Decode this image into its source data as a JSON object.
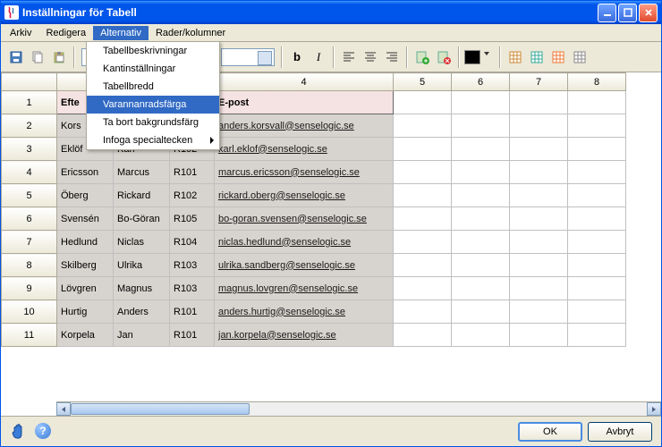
{
  "window": {
    "title": "Inställningar för Tabell"
  },
  "menubar": {
    "items": [
      "Arkiv",
      "Redigera",
      "Alternativ",
      "Rader/kolumner"
    ],
    "open_index": 2
  },
  "dropdown": {
    "items": [
      {
        "label": "Tabellbeskrivningar",
        "submenu": false
      },
      {
        "label": "Kantinställningar",
        "submenu": false
      },
      {
        "label": "Tabellbredd",
        "submenu": false
      },
      {
        "label": "Varannanradsfärga",
        "submenu": false,
        "hover": true
      },
      {
        "label": "Ta bort bakgrundsfärg",
        "submenu": false
      },
      {
        "label": "Infoga specialtecken",
        "submenu": true
      }
    ]
  },
  "columns": {
    "visible_numbers": [
      "4",
      "5",
      "6",
      "7",
      "8"
    ]
  },
  "headers": {
    "c1_partial": "Efte",
    "c4": "E-post"
  },
  "rows": [
    {
      "n": "1"
    },
    {
      "n": "2",
      "c1": "Kors",
      "email": "anders.korsvall@senselogic.se"
    },
    {
      "n": "3",
      "c1": "Eklöf",
      "c2": "Karl",
      "c3": "R102",
      "email": "karl.eklof@senselogic.se"
    },
    {
      "n": "4",
      "c1": "Ericsson",
      "c2": "Marcus",
      "c3": "R101",
      "email": "marcus.ericsson@senselogic.se"
    },
    {
      "n": "5",
      "c1": "Öberg",
      "c2": "Rickard",
      "c3": "R102",
      "email": "rickard.oberg@senselogic.se"
    },
    {
      "n": "6",
      "c1": "Svensén",
      "c2": "Bo-Göran",
      "c3": "R105",
      "email": "bo-goran.svensen@senselogic.se"
    },
    {
      "n": "7",
      "c1": "Hedlund",
      "c2": "Niclas",
      "c3": "R104",
      "email": "niclas.hedlund@senselogic.se"
    },
    {
      "n": "8",
      "c1": "Skilberg",
      "c2": "Ulrika",
      "c3": "R103",
      "email": "ulrika.sandberg@senselogic.se"
    },
    {
      "n": "9",
      "c1": "Lövgren",
      "c2": "Magnus",
      "c3": "R103",
      "email": "magnus.lovgren@senselogic.se"
    },
    {
      "n": "10",
      "c1": "Hurtig",
      "c2": "Anders",
      "c3": "R101",
      "email": "anders.hurtig@senselogic.se"
    },
    {
      "n": "11",
      "c1": "Korpela",
      "c2": "Jan",
      "c3": "R101",
      "email": "jan.korpela@senselogic.se"
    }
  ],
  "footer": {
    "ok": "OK",
    "cancel": "Avbryt"
  }
}
